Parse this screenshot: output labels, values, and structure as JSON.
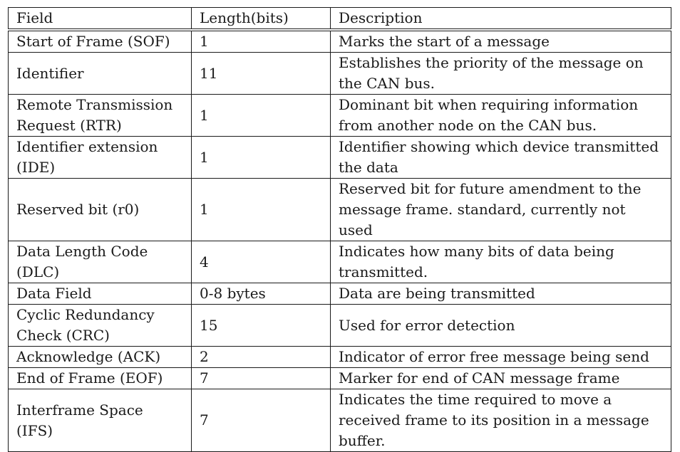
{
  "table": {
    "headers": [
      "Field",
      "Length(bits)",
      "Description"
    ],
    "rows": [
      {
        "field": "Start of Frame (SOF)",
        "length": "1",
        "description": "Marks the start of a message"
      },
      {
        "field": "Identifier",
        "length": "11",
        "description": "Establishes the priority of the message on the CAN bus."
      },
      {
        "field": "Remote Transmission Request (RTR)",
        "length": "1",
        "description": "Dominant bit when requiring information from another node on the CAN bus."
      },
      {
        "field": "Identifier extension (IDE)",
        "length": "1",
        "description": "Identifier showing which device transmitted the data"
      },
      {
        "field": "Reserved bit (r0)",
        "length": "1",
        "description": "Reserved bit for future amendment to the message frame. standard, currently not used"
      },
      {
        "field": "Data Length Code (DLC)",
        "length": "4",
        "description": "Indicates how many bits of data being transmitted."
      },
      {
        "field": "Data Field",
        "length": "0-8 bytes",
        "description": "Data are being transmitted"
      },
      {
        "field": "Cyclic Redundancy Check (CRC)",
        "length": "15",
        "description": "Used for error detection"
      },
      {
        "field": "Acknowledge (ACK)",
        "length": "2",
        "description": "Indicator of error free message being send"
      },
      {
        "field": "End of Frame (EOF)",
        "length": "7",
        "description": "Marker for end of CAN message frame"
      },
      {
        "field": "Interframe Space (IFS)",
        "length": "7",
        "description": "Indicates the time required to move a received frame to its position in a message buffer."
      }
    ]
  }
}
